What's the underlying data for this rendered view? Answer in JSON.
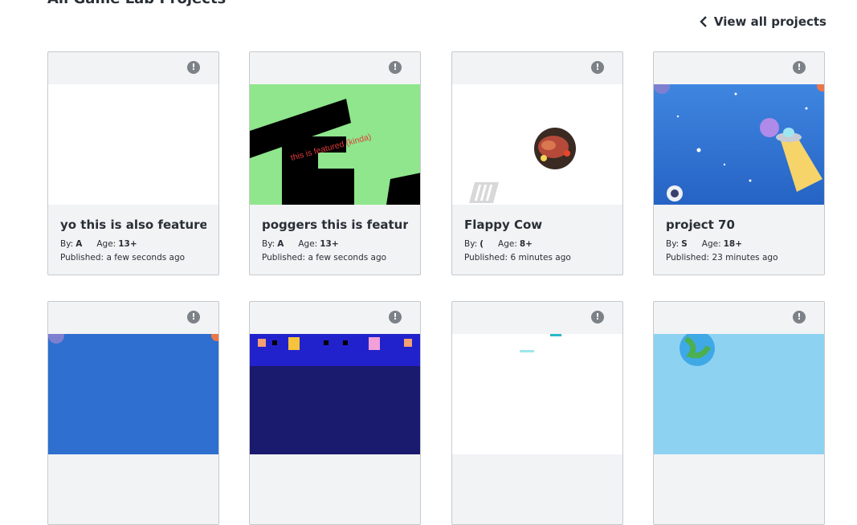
{
  "section": {
    "title": "All Game Lab Projects",
    "view_all_label": "View all projects"
  },
  "labels": {
    "by": "By:",
    "age": "Age:",
    "published": "Published:"
  },
  "cards": [
    {
      "name": "yo this is also featured",
      "author": "A",
      "age": "13+",
      "published": "a few seconds ago",
      "thumb": "blank"
    },
    {
      "name": "poggers this is featured",
      "author": "A",
      "age": "13+",
      "published": "a few seconds ago",
      "thumb": "green-letters",
      "thumb_text": "this is featured (kinda)"
    },
    {
      "name": "Flappy Cow",
      "author": "(",
      "age": "8+",
      "published": "6 minutes ago",
      "thumb": "steak"
    },
    {
      "name": "project 70",
      "author": "S",
      "age": "18+",
      "published": "23 minutes ago",
      "thumb": "space"
    }
  ],
  "info_icon_glyph": "!",
  "colors": {
    "card_bg": "#f2f3f5",
    "border": "#c6cacd",
    "text": "#292f36",
    "green_thumb": "#8fe68c",
    "space": "#2766c9"
  }
}
